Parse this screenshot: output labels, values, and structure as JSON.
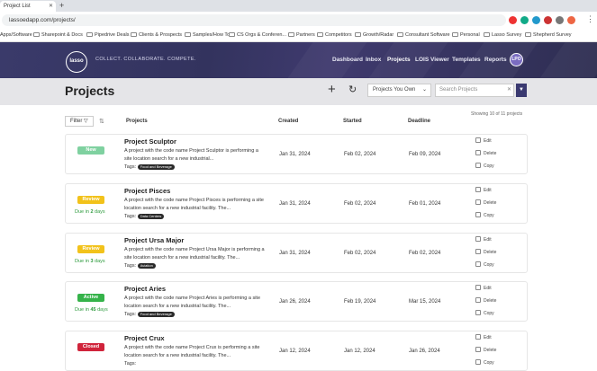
{
  "browser": {
    "tab_title": "Project List",
    "url": "lassoedapp.com/projects/",
    "bookmarks": [
      "Apps/Software",
      "Sharepoint & Docs",
      "Pipedrive Deals",
      "Clients & Prospects",
      "Samples/How To",
      "CS Orgs & Conferen...",
      "Partners",
      "Competitors",
      "Growth/Radar",
      "Consultant Software",
      "Personal",
      "Lasso Survey",
      "Shepherd Survey"
    ]
  },
  "header": {
    "logo": "lasso",
    "tagline": "COLLECT. COLLABORATE. COMPETE.",
    "nav": [
      "Dashboard",
      "Inbox",
      "Projects",
      "LOIS Viewer",
      "Templates",
      "Reports"
    ],
    "active_nav": "Projects",
    "avatar": "LPO"
  },
  "toolbar": {
    "title": "Projects",
    "plus_icon": "+",
    "refresh_icon": "↻",
    "filter_select": "Projects You Own",
    "search_placeholder": "Search Projects"
  },
  "list": {
    "filter_label": "Filter",
    "showing": "Showing 10 of 11 projects",
    "columns": {
      "projects": "Projects",
      "created": "Created",
      "started": "Started",
      "deadline": "Deadline"
    },
    "tags_label": "Tags:",
    "actions": {
      "edit": "Edit",
      "delete": "Delete",
      "copy": "Copy"
    },
    "rows": [
      {
        "status": "New",
        "status_color": "#7fd1a0",
        "due_prefix": "",
        "due_value": "",
        "due_suffix": "",
        "name": "Project Sculptor",
        "desc": "A project with the code name Project Sculptor is performing a site location search for a new industrial...",
        "tag": "Food and Beverage",
        "created": "Jan 31, 2024",
        "started": "Feb 02, 2024",
        "deadline": "Feb 09, 2024"
      },
      {
        "status": "Review",
        "status_color": "#f2c21b",
        "due_prefix": "Due in ",
        "due_value": "2",
        "due_suffix": " days",
        "name": "Project Pisces",
        "desc": "A project with the code name Project Pisces is performing a site location search for a new industrial facility. The...",
        "tag": "Data Centers",
        "created": "Jan 31, 2024",
        "started": "Feb 02, 2024",
        "deadline": "Feb 01, 2024"
      },
      {
        "status": "Review",
        "status_color": "#f2c21b",
        "due_prefix": "Due in ",
        "due_value": "3",
        "due_suffix": " days",
        "name": "Project Ursa Major",
        "desc": "A project with the code name Project Ursa Major is performing a site location search for a new industrial facility. The...",
        "tag": "Aviation",
        "created": "Jan 31, 2024",
        "started": "Feb 02, 2024",
        "deadline": "Feb 02, 2024"
      },
      {
        "status": "Active",
        "status_color": "#35b34a",
        "due_prefix": "Due in ",
        "due_value": "45",
        "due_suffix": " days",
        "name": "Project Aries",
        "desc": "A project with the code name Project Aries is performing a site location search for a new industrial facility. The...",
        "tag": "Food and Beverage",
        "created": "Jan 26, 2024",
        "started": "Feb 19, 2024",
        "deadline": "Mar 15, 2024"
      },
      {
        "status": "Closed",
        "status_color": "#d0243b",
        "due_prefix": "",
        "due_value": "",
        "due_suffix": "",
        "name": "Project Crux",
        "desc": "A project with the code name Project Crux is performing a site location search for a new industrial facility. The...",
        "tag": "",
        "created": "Jan 12, 2024",
        "started": "Jan 12, 2024",
        "deadline": "Jan 26, 2024"
      }
    ]
  }
}
